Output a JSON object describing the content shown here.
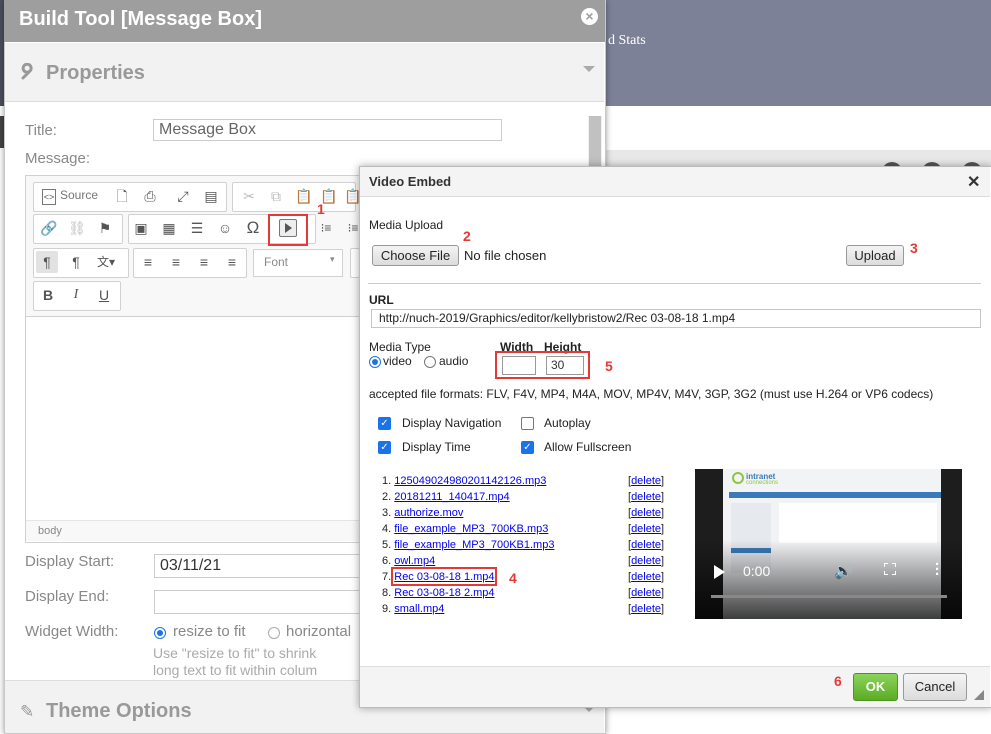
{
  "background": {
    "header_fragment": "d Stats"
  },
  "build_tool": {
    "title": "Build Tool [Message Box]",
    "close_glyph": "×",
    "properties_title": "Properties",
    "title_label": "Title:",
    "title_value": "Message Box",
    "message_label": "Message:",
    "toolbar": {
      "source_label": "Source",
      "font_label": "Font",
      "icons": [
        "source-icon",
        "preview-icon",
        "print-icon",
        "maximize-icon",
        "show-blocks-icon",
        "cut-icon",
        "copy-icon",
        "paste-icon",
        "paste-text-icon",
        "paste-word-icon",
        "link-icon",
        "unlink-icon",
        "anchor-icon",
        "image-icon",
        "table-icon",
        "horizontal-rule-icon",
        "smiley-icon",
        "special-char-icon",
        "video-embed-icon",
        "numbered-list-icon",
        "bulleted-list-icon",
        "ltr-icon",
        "rtl-icon",
        "language-icon",
        "align-left-icon",
        "align-center-icon",
        "align-right-icon",
        "justify-icon",
        "bold-icon",
        "italic-icon",
        "underline-icon"
      ]
    },
    "status_path": "body",
    "display_start_label": "Display Start:",
    "display_start_value": "03/11/21",
    "display_end_label": "Display End:",
    "display_end_value": "",
    "widget_width_label": "Widget Width:",
    "widget_width_options": [
      "resize to fit",
      "horizontal"
    ],
    "widget_width_selected": "resize to fit",
    "help_line1": "Use \"resize to fit\" to shrink",
    "help_line2": "long text to fit within colum",
    "theme_options_title": "Theme Options"
  },
  "annotations": {
    "n1": "1",
    "n2": "2",
    "n3": "3",
    "n4": "4",
    "n5": "5",
    "n6": "6"
  },
  "video_embed": {
    "title": "Video Embed",
    "close_glyph": "✕",
    "media_upload_label": "Media Upload",
    "choose_file_label": "Choose File",
    "no_file_text": "No file chosen",
    "upload_label": "Upload",
    "url_label": "URL",
    "url_value": "http://nuch-2019/Graphics/editor/kellybristow2/Rec 03-08-18 1.mp4",
    "media_type_label": "Media Type",
    "media_type_options": [
      "video",
      "audio"
    ],
    "media_type_selected": "video",
    "width_label": "Width",
    "height_label": "Height",
    "width_value": "",
    "height_value": "30",
    "accepted_formats": "accepted file formats: FLV, F4V, MP4, M4A, MOV, MP4V, M4V, 3GP, 3G2 (must use H.264 or VP6 codecs)",
    "options": {
      "display_navigation": {
        "label": "Display Navigation",
        "checked": true
      },
      "autoplay": {
        "label": "Autoplay",
        "checked": false
      },
      "display_time": {
        "label": "Display Time",
        "checked": true
      },
      "allow_fullscreen": {
        "label": "Allow Fullscreen",
        "checked": true
      }
    },
    "files": [
      {
        "num": "1.",
        "name": "125049024980201142126.mp3"
      },
      {
        "num": "2.",
        "name": "20181211_140417.mp4"
      },
      {
        "num": "3.",
        "name": "authorize.mov"
      },
      {
        "num": "4.",
        "name": "file_example_MP3_700KB.mp3"
      },
      {
        "num": "5.",
        "name": "file_example_MP3_700KB1.mp3"
      },
      {
        "num": "6.",
        "name": "owl.mp4"
      },
      {
        "num": "7.",
        "name": "Rec 03-08-18 1.mp4"
      },
      {
        "num": "8.",
        "name": "Rec 03-08-18 2.mp4"
      },
      {
        "num": "9.",
        "name": "small.mp4"
      }
    ],
    "delete_text": "delete",
    "player": {
      "time": "0:00",
      "thumb_logo_text": "intranet",
      "thumb_logo_sub": "connections"
    },
    "ok_label": "OK",
    "cancel_label": "Cancel"
  }
}
